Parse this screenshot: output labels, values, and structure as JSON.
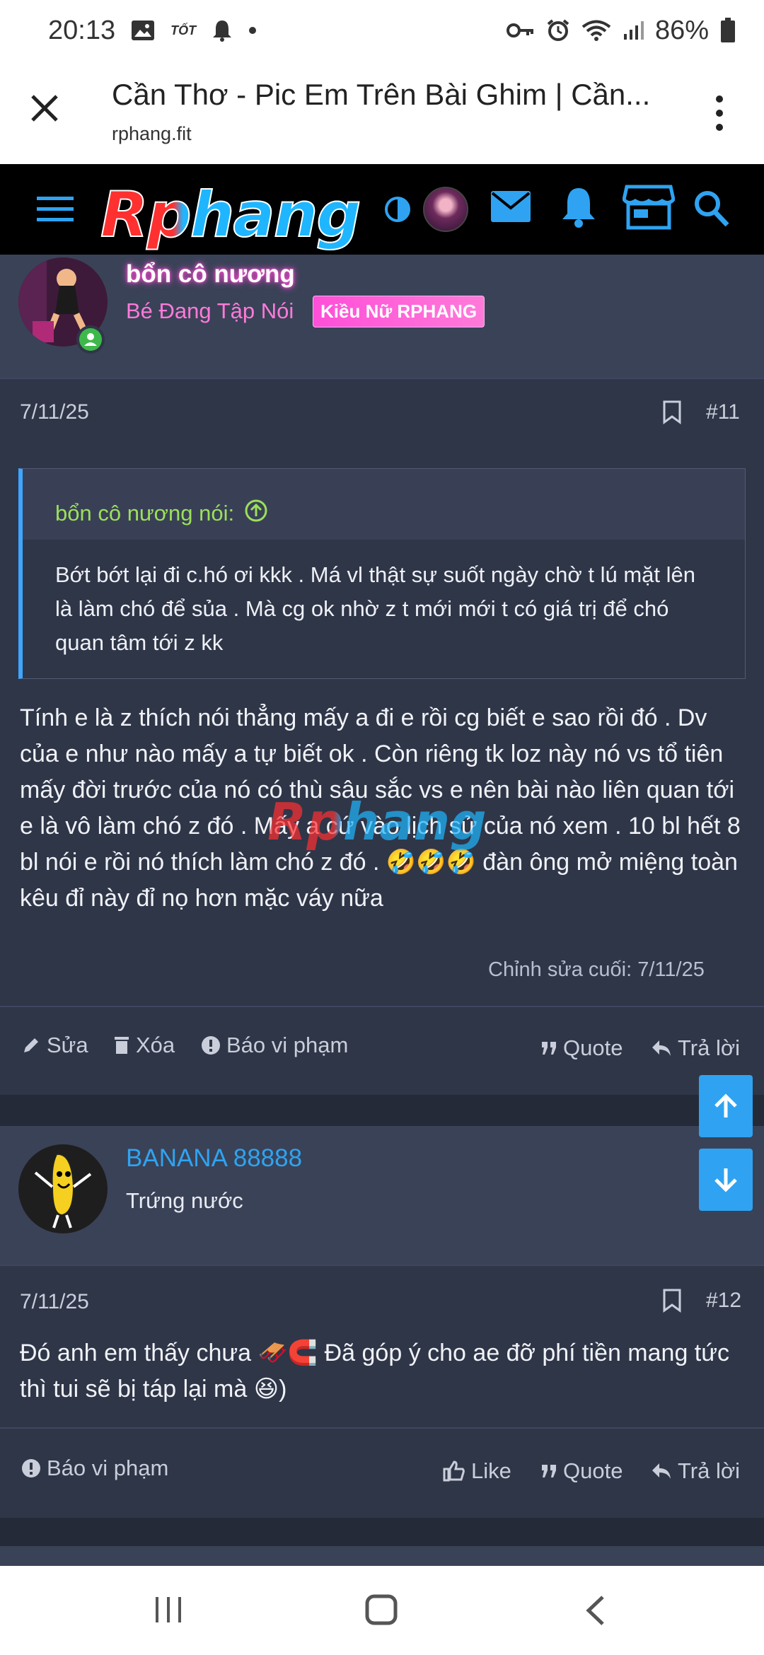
{
  "status": {
    "time": "20:13",
    "carrier_mark": "TỐT",
    "battery": "86%"
  },
  "tab": {
    "title": "Cần Thơ - Pic Em Trên Bài Ghim | Cần...",
    "url": "rphang.fit"
  },
  "site": {
    "logo": "Rphang"
  },
  "post11": {
    "username": "bổn cô nương",
    "user_title": "Bé Đang Tập Nói",
    "badge": "Kiều Nữ RPHANG",
    "date": "7/11/25",
    "number": "#11",
    "quote_author": "bổn cô nương nói:",
    "quote_text": "Bớt bớt lại đi c.hó ơi kkk . Má vl thật sự suốt ngày chờ t lú mặt lên là làm chó để sủa . Mà cg ok nhờ z t mới mới t có giá trị để chó quan tâm tới z kk",
    "body": "Tính e là z thích nói thẳng mấy a đi e rồi cg biết e sao rồi đó . Dv của e như nào mấy a tự biết ok . Còn riêng tk loz này nó vs tổ tiên mấy đời trước của nó có thù sâu sắc vs e nên bài nào liên quan tới e là vô làm chó z đó . Mấy a cứ vào lịch sử của nó xem . 10 bl hết 8 bl nói e rồi nó thích làm chó z đó . 🤣🤣🤣 đàn ông mở miệng toàn kêu đỉ này đỉ nọ hơn mặc váy nữa",
    "edited": "Chỉnh sửa cuối: 7/11/25",
    "actions": {
      "edit": "Sửa",
      "delete": "Xóa",
      "report": "Báo vi phạm",
      "quote": "Quote",
      "reply": "Trả lời"
    }
  },
  "post12": {
    "username": "BANANA 88888",
    "user_title": "Trứng nước",
    "date": "7/11/25",
    "number": "#12",
    "body": "Đó anh em thấy chưa 🛷🧲 Đã góp ý cho ae đỡ phí tiền mang tức thì tui sẽ bị táp lại mà 😆)",
    "actions": {
      "report": "Báo vi phạm",
      "like": "Like",
      "quote": "Quote",
      "reply": "Trả lời"
    }
  },
  "watermark": "Rphang",
  "colors": {
    "accent": "#2fa3f1",
    "bg": "#2f3648",
    "userbar": "#3a4257",
    "quote_author": "#9be05a",
    "username_blue": "#2fa3f1"
  }
}
